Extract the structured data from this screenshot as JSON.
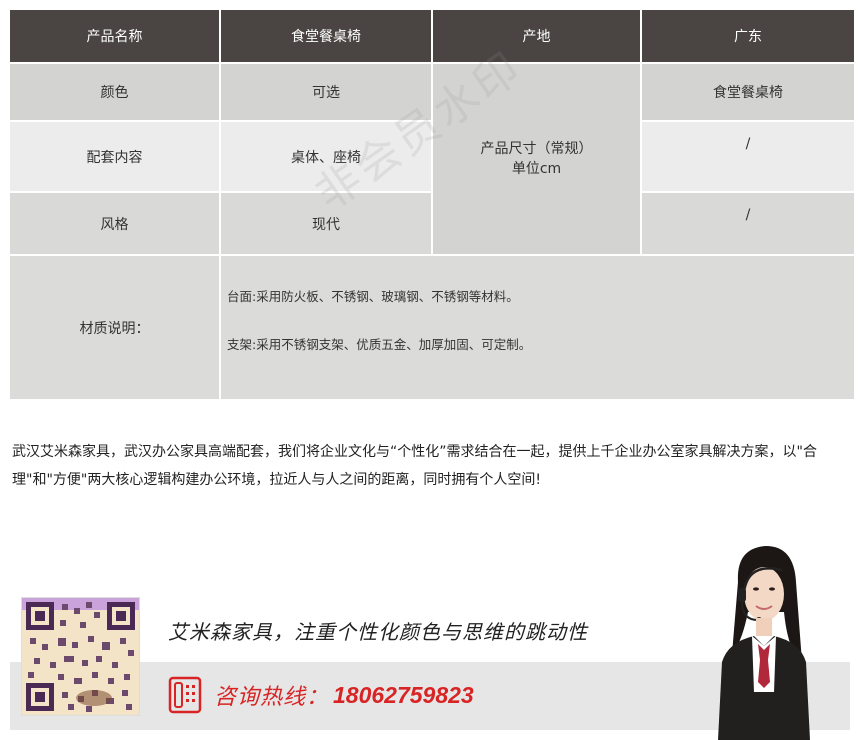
{
  "table": {
    "header": [
      "产品名称",
      "食堂餐桌椅",
      "产地",
      "广东"
    ],
    "rows": [
      {
        "label": "颜色",
        "value": "可选",
        "right": "食堂餐桌椅"
      },
      {
        "label": "配套内容",
        "value": "桌体、座椅",
        "right": "/"
      },
      {
        "label": "风格",
        "value": "现代",
        "right": "/"
      }
    ],
    "size_cell": {
      "line1": "产品尺寸（常规）",
      "line2": "单位cm"
    },
    "material": {
      "label": "材质说明：",
      "lines": [
        "台面:采用防火板、不锈钢、玻璃钢、不锈钢等材料。",
        "支架:采用不锈钢支架、优质五金、加厚加固、可定制。"
      ]
    },
    "watermark": "非会员水印"
  },
  "intro": "武汉艾米森家具，武汉办公家具高端配套，我们将企业文化与“个性化”需求结合在一起，提供上千企业办公室家具解决方案，以\"合理\"和\"方便\"两大核心逻辑构建办公环境，拉近人与人之间的距离，同时拥有个人空间!",
  "banner": {
    "slogan": "艾米森家具，注重个性化颜色与思维的跳动性",
    "hotline_label": "咨询热线：",
    "hotline_number": "18062759823",
    "accent_color": "#d82424",
    "icons": [
      "qr-code-icon",
      "phone-icon",
      "customer-service-agent-icon"
    ]
  }
}
